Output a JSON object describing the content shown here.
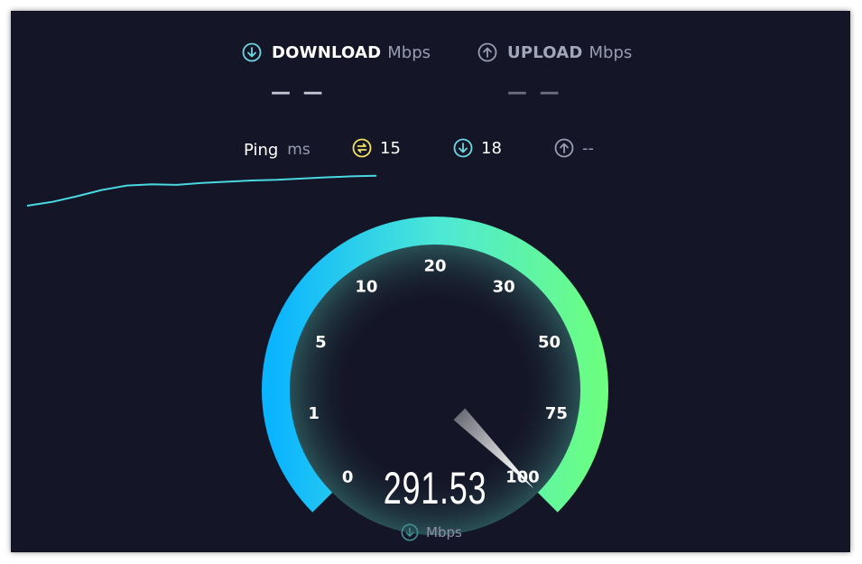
{
  "download": {
    "label": "DOWNLOAD",
    "unit": "Mbps",
    "value": "— —",
    "icon": "download-arrow-icon"
  },
  "upload": {
    "label": "UPLOAD",
    "unit": "Mbps",
    "value": "— —",
    "icon": "upload-arrow-icon"
  },
  "ping": {
    "label": "Ping",
    "unit": "ms",
    "idle": {
      "value": "15",
      "icon": "idle-latency-icon"
    },
    "download": {
      "value": "18",
      "icon": "download-arrow-icon"
    },
    "upload": {
      "value": "--",
      "icon": "upload-arrow-icon"
    }
  },
  "gauge": {
    "ticks": [
      "0",
      "1",
      "5",
      "10",
      "20",
      "30",
      "50",
      "75",
      "100"
    ],
    "needle_fraction": 1.0,
    "speed": "291.53",
    "speed_unit": "Mbps",
    "colors": {
      "start": "#0ab4ff",
      "mid": "#4de8d6",
      "end": "#6dff7e",
      "accent": "#6fd7e3",
      "ping_yellow": "#f2e463"
    }
  },
  "history_graph": {
    "points": [
      0,
      0.12,
      0.3,
      0.5,
      0.64,
      0.68,
      0.66,
      0.72,
      0.76,
      0.8,
      0.82,
      0.86,
      0.9,
      0.93,
      0.95
    ]
  }
}
